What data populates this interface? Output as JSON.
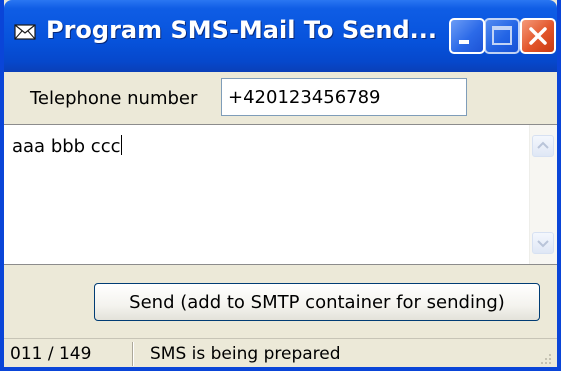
{
  "window": {
    "title": "Program SMS-Mail To Send...",
    "title_icon": "envelope-icon",
    "buttons": [
      "minimize-icon",
      "maximize-icon",
      "close-icon"
    ]
  },
  "form": {
    "telephone_label": "Telephone number",
    "telephone_value": "+420123456789",
    "message_text": "aaa bbb ccc"
  },
  "send_button": {
    "label": "Send   (add to SMTP container for sending)"
  },
  "statusbar": {
    "count": "011 / 149",
    "status": "SMS is being prepared"
  },
  "colors": {
    "titlebar": "#0753dc",
    "window_face": "#ece9d8",
    "close_button": "#e2552a"
  }
}
